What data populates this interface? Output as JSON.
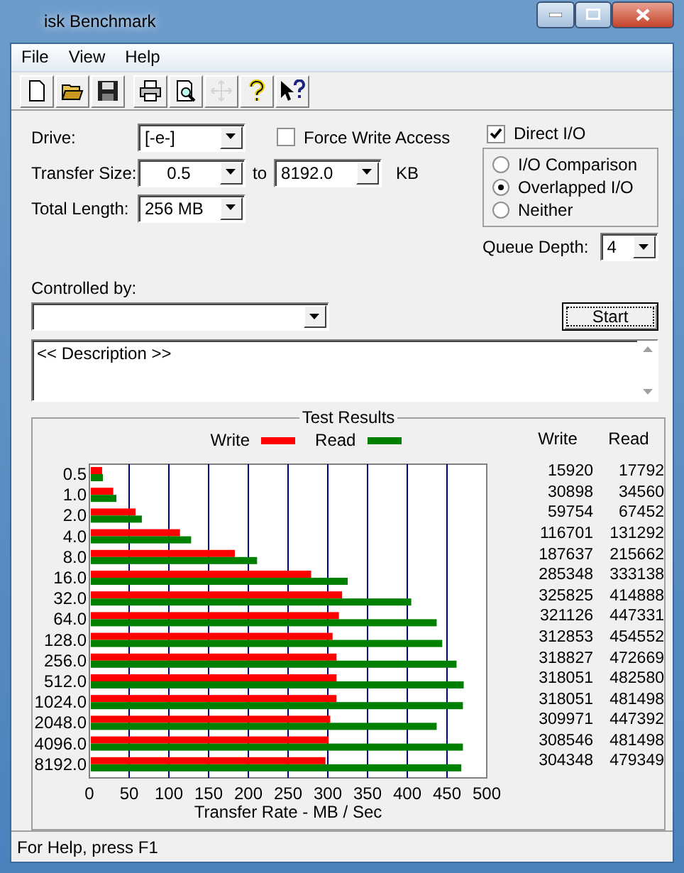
{
  "window": {
    "title": "isk Benchmark"
  },
  "menu": [
    "File",
    "View",
    "Help"
  ],
  "toolbar": [
    {
      "kind": "new",
      "disabled": false
    },
    {
      "kind": "open",
      "disabled": false
    },
    {
      "kind": "save",
      "disabled": false
    },
    {
      "kind": "print",
      "disabled": false
    },
    {
      "kind": "preview",
      "disabled": false
    },
    {
      "kind": "move",
      "disabled": true
    },
    {
      "kind": "help",
      "disabled": false
    },
    {
      "kind": "context-help",
      "disabled": false
    }
  ],
  "drive": {
    "label": "Drive:",
    "value": "[-e-]"
  },
  "transfer_size": {
    "label": "Transfer Size:",
    "from": "0.5",
    "to_label": "to",
    "to": "8192.0",
    "unit": "KB"
  },
  "total_length": {
    "label": "Total Length:",
    "value": "256 MB"
  },
  "force_write_access": {
    "label": "Force Write Access",
    "checked": false
  },
  "direct_io": {
    "label": "Direct I/O",
    "checked": true
  },
  "io_modes": [
    {
      "label": "I/O Comparison",
      "selected": false
    },
    {
      "label": "Overlapped I/O",
      "selected": true
    },
    {
      "label": "Neither",
      "selected": false
    }
  ],
  "queue_depth": {
    "label": "Queue Depth:",
    "value": "4"
  },
  "controlled_by": {
    "label": "Controlled by:"
  },
  "start_button": "Start",
  "description": "<< Description >>",
  "test_results": {
    "title": "Test Results",
    "columns": [
      "Write",
      "Read"
    ],
    "rows": [
      {
        "write": "15920",
        "read": "17792"
      },
      {
        "write": "30898",
        "read": "34560"
      },
      {
        "write": "59754",
        "read": "67452"
      },
      {
        "write": "116701",
        "read": "131292"
      },
      {
        "write": "187637",
        "read": "215662"
      },
      {
        "write": "285348",
        "read": "333138"
      },
      {
        "write": "325825",
        "read": "414888"
      },
      {
        "write": "321126",
        "read": "447331"
      },
      {
        "write": "312853",
        "read": "454552"
      },
      {
        "write": "318827",
        "read": "472669"
      },
      {
        "write": "318051",
        "read": "482580"
      },
      {
        "write": "318051",
        "read": "481498"
      },
      {
        "write": "309971",
        "read": "447392"
      },
      {
        "write": "308546",
        "read": "481498"
      },
      {
        "write": "304348",
        "read": "479349"
      }
    ],
    "chart_data": {
      "type": "bar",
      "orientation": "horizontal",
      "xlabel": "Transfer Rate - MB / Sec",
      "categories": [
        "0.5",
        "1.0",
        "2.0",
        "4.0",
        "8.0",
        "16.0",
        "32.0",
        "64.0",
        "128.0",
        "256.0",
        "512.0",
        "1024.0",
        "2048.0",
        "4096.0",
        "8192.0"
      ],
      "series": [
        {
          "name": "Write",
          "color": "#ff0000",
          "values": [
            16,
            30,
            58,
            114,
            183,
            279,
            318,
            314,
            306,
            311,
            311,
            311,
            303,
            301,
            297
          ]
        },
        {
          "name": "Read",
          "color": "#008000",
          "values": [
            17,
            34,
            66,
            128,
            211,
            325,
            405,
            437,
            444,
            462,
            471,
            470,
            437,
            470,
            468
          ]
        }
      ],
      "grid": true,
      "xlim": [
        0,
        500
      ],
      "xticks": [
        0,
        50,
        100,
        150,
        200,
        250,
        300,
        350,
        400,
        450,
        500
      ]
    }
  },
  "status_bar": "For Help, press F1"
}
